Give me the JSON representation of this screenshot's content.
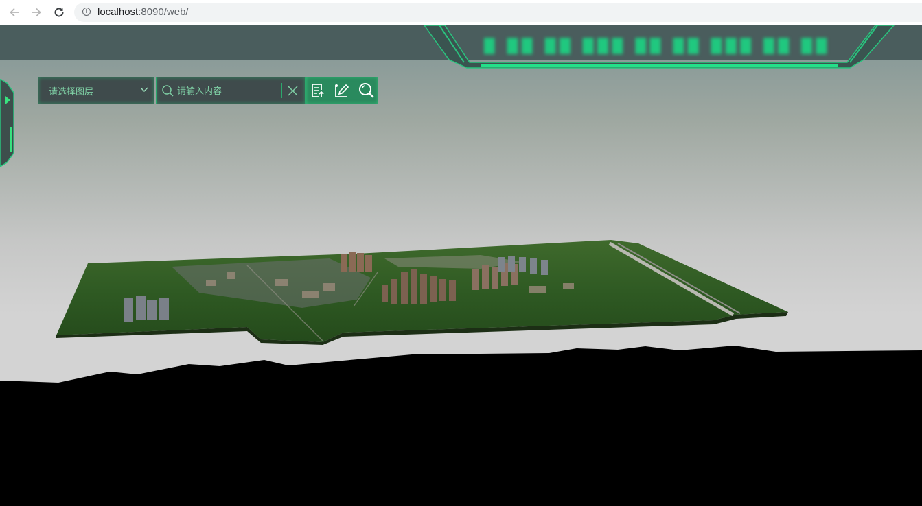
{
  "browser": {
    "url_host": "localhost",
    "url_port_path": ":8090/web/"
  },
  "app": {
    "title": "█ ██ ██ ███ ██ ██ ███ ██ ██ ██"
  },
  "toolbar": {
    "layer_select_placeholder": "请选择图层",
    "search_placeholder": "请输入内容"
  },
  "colors": {
    "accent": "#2ba86c",
    "header_bg": "#4a5d5d",
    "text_accent": "#7ecfa4",
    "title_green": "#20c87f"
  }
}
